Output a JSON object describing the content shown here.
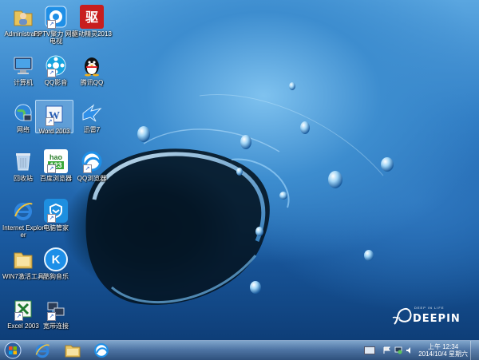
{
  "desktop_icons": [
    {
      "id": "administrator",
      "label": "Administrator",
      "icon": "user-folder-icon"
    },
    {
      "id": "pptv",
      "label": "PPTV聚力 网络电视",
      "icon": "pptv-icon"
    },
    {
      "id": "driver-wizard",
      "label": "驱动精灵2013",
      "icon": "driver-wizard-icon"
    },
    {
      "id": "computer",
      "label": "计算机",
      "icon": "computer-icon"
    },
    {
      "id": "qqplayer",
      "label": "QQ影音",
      "icon": "qqplayer-icon"
    },
    {
      "id": "tencent-qq",
      "label": "腾讯QQ",
      "icon": "qq-penguin-icon"
    },
    {
      "id": "network",
      "label": "网络",
      "icon": "network-globe-icon"
    },
    {
      "id": "word2003",
      "label": "Word 2003",
      "icon": "word-icon"
    },
    {
      "id": "xunlei",
      "label": "迅雷7",
      "icon": "xunlei-bird-icon"
    },
    {
      "id": "recycle-bin",
      "label": "回收站",
      "icon": "recycle-bin-icon"
    },
    {
      "id": "hao123",
      "label": "百度浏览器",
      "icon": "hao123-icon",
      "glyph_text": "hao",
      "glyph_sub": "123"
    },
    {
      "id": "qq-browser",
      "label": "QQ浏览器",
      "icon": "qq-browser-icon"
    },
    {
      "id": "ie",
      "label": "Internet Explorer",
      "icon": "internet-explorer-icon"
    },
    {
      "id": "pc-manager",
      "label": "电脑管家",
      "icon": "pc-manager-shield-icon"
    },
    {
      "id": "win7-activator",
      "label": "WIN7激活工具",
      "icon": "activator-folder-icon"
    },
    {
      "id": "kuwo",
      "label": "酷狗音乐",
      "icon": "kugou-icon",
      "glyph_text": "K"
    },
    {
      "id": "excel2003",
      "label": "Excel 2003",
      "icon": "excel-icon"
    },
    {
      "id": "broadband",
      "label": "宽带连接",
      "icon": "broadband-connection-icon"
    }
  ],
  "selected_icon": "word2003",
  "wallpaper": {
    "brand": "DEEPIN",
    "tagline": "DEEP IN LIFE"
  },
  "taskbar": {
    "start": "start-orb-icon",
    "pinned": [
      {
        "id": "ie",
        "icon": "internet-explorer-icon"
      },
      {
        "id": "explorer",
        "icon": "file-explorer-icon"
      },
      {
        "id": "qq-browser",
        "icon": "qq-browser-icon"
      }
    ],
    "tray_icons": [
      "keyboard-icon",
      "flag-icon",
      "network-tray-icon",
      "volume-icon"
    ],
    "clock": {
      "time": "上午 12:34",
      "date": "2014/10/4 星期六"
    }
  },
  "colors": {
    "taskbar": "#3f6fa3",
    "selection": "#b4d7f5"
  }
}
